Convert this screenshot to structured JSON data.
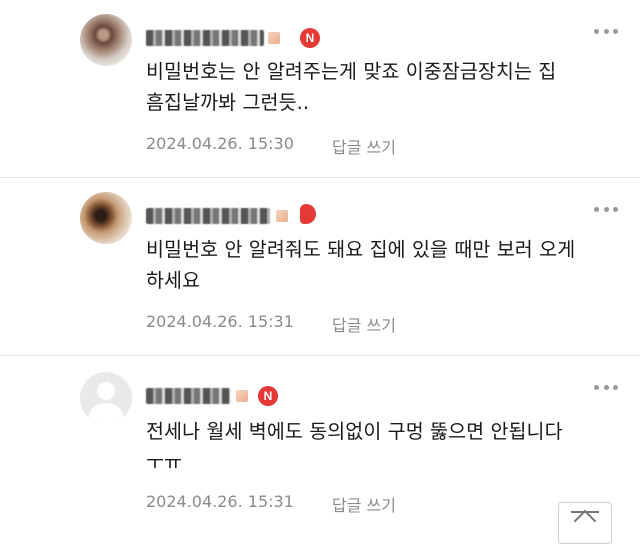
{
  "comments": [
    {
      "badge": "N",
      "text": "비밀번호는 안 알려주는게 맞죠 이중잠금장치는 집\n흠집날까봐 그런듯..",
      "date": "2024.04.26. 15:30",
      "reply_label": "답글 쓰기",
      "avatar": "blurred-profile-photo"
    },
    {
      "badge": "",
      "text": "비밀번호 안 알려줘도 돼요 집에 있을 때만 보러 오게\n하세요",
      "date": "2024.04.26. 15:31",
      "reply_label": "답글 쓰기",
      "avatar": "blurred-profile-photo"
    },
    {
      "badge": "N",
      "text": "전세나 월세 벽에도 동의없이 구멍 뚫으면 안됩니다\nㅜㅠ",
      "date": "2024.04.26. 15:31",
      "reply_label": "답글 쓰기",
      "avatar": "default-user-icon"
    }
  ],
  "icons": {
    "more": "more-options-icon",
    "top": "scroll-to-top-icon"
  },
  "colors": {
    "badge": "#e53935",
    "meta_text": "#8a8a8a",
    "divider": "#e4e4e4"
  }
}
